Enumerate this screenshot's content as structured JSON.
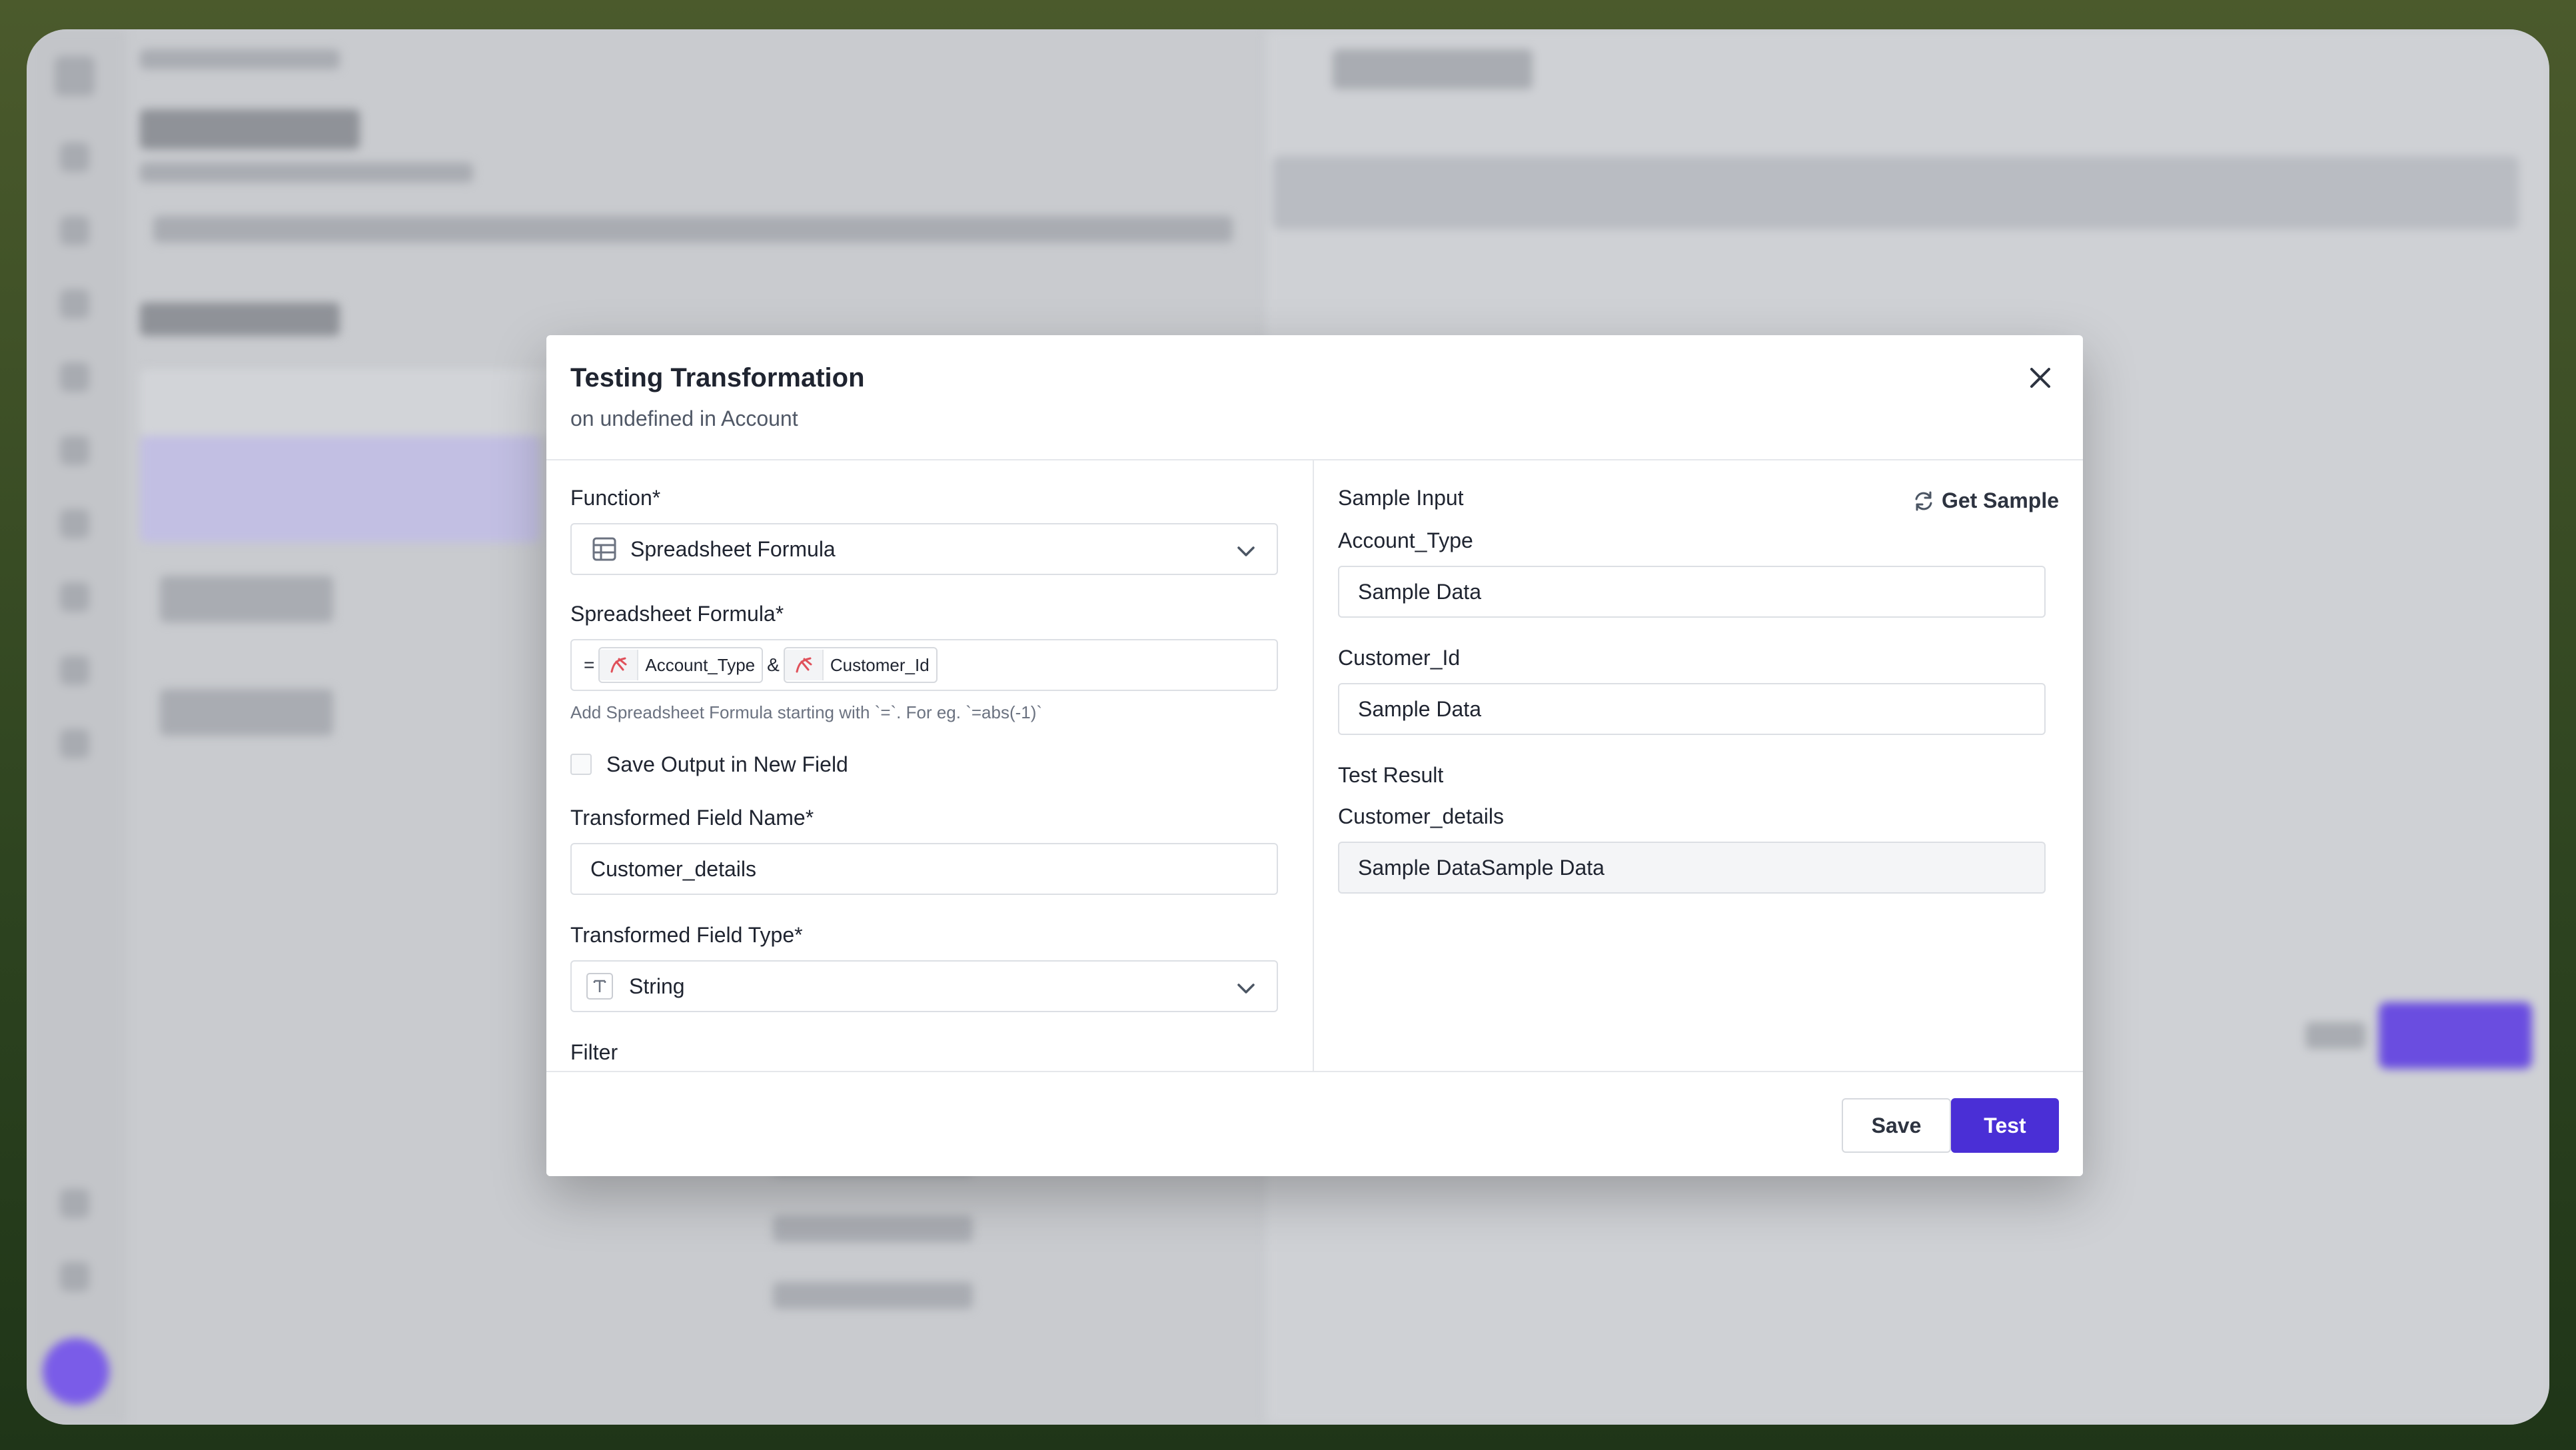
{
  "modal": {
    "title": "Testing Transformation",
    "subtitle": "on undefined in Account",
    "close_icon": "close-icon"
  },
  "left": {
    "function_label": "Function*",
    "function_value": "Spreadsheet Formula",
    "formula_label": "Spreadsheet Formula*",
    "formula": {
      "prefix": "=",
      "chip1": "Account_Type",
      "operator": "&",
      "chip2": "Customer_Id"
    },
    "formula_hint": "Add Spreadsheet Formula starting with `=`. For eg. `=abs(-1)`",
    "save_output_label": "Save Output in New Field",
    "save_output_checked": false,
    "field_name_label": "Transformed Field Name*",
    "field_name_value": "Customer_details",
    "field_type_label": "Transformed Field Type*",
    "field_type_value": "String",
    "filter_label": "Filter"
  },
  "right": {
    "sample_input_label": "Sample Input",
    "get_sample_label": "Get Sample",
    "input1_label": "Account_Type",
    "input1_value": "Sample Data",
    "input2_label": "Customer_Id",
    "input2_value": "Sample Data",
    "test_result_label": "Test Result",
    "result_field_label": "Customer_details",
    "result_value": "Sample DataSample Data"
  },
  "footer": {
    "save_label": "Save",
    "test_label": "Test"
  },
  "colors": {
    "primary": "#4a2fd6",
    "chip_icon": "#e0505a"
  }
}
